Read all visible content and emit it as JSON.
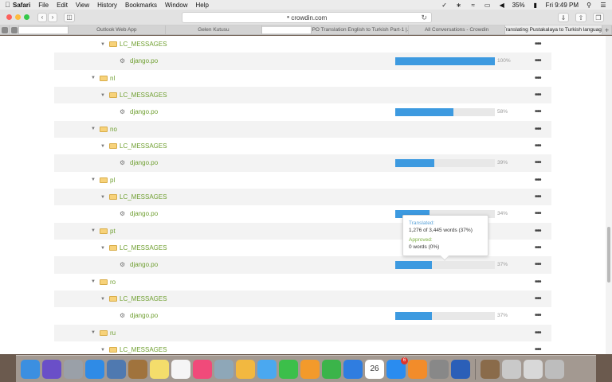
{
  "menubar": {
    "app": "Safari",
    "menus": [
      "File",
      "Edit",
      "View",
      "History",
      "Bookmarks",
      "Window",
      "Help"
    ],
    "battery": "35%",
    "clock": "Fri 9:49 PM"
  },
  "toolbar": {
    "url": "crowdin.com"
  },
  "tabs": [
    {
      "label": "Outlook Web App"
    },
    {
      "label": "Gelen Kutusu"
    },
    {
      "label": "HPO Translation English to Turkish Part-1 |..."
    },
    {
      "label": "All Conversations - Crowdin"
    },
    {
      "label": "Translating Pustakalaya to Turkish language"
    }
  ],
  "files": [
    {
      "type": "folder",
      "level": 2,
      "name": "LC_MESSAGES"
    },
    {
      "type": "file",
      "name": "django.po",
      "progress": 100,
      "pct": "100%"
    },
    {
      "type": "folder",
      "level": 1,
      "name": "nl"
    },
    {
      "type": "folder",
      "level": 2,
      "name": "LC_MESSAGES"
    },
    {
      "type": "file",
      "name": "django.po",
      "progress": 58,
      "pct": "58%"
    },
    {
      "type": "folder",
      "level": 1,
      "name": "no"
    },
    {
      "type": "folder",
      "level": 2,
      "name": "LC_MESSAGES"
    },
    {
      "type": "file",
      "name": "django.po",
      "progress": 39,
      "pct": "39%"
    },
    {
      "type": "folder",
      "level": 1,
      "name": "pl"
    },
    {
      "type": "folder",
      "level": 2,
      "name": "LC_MESSAGES"
    },
    {
      "type": "file",
      "name": "django.po",
      "progress": 34,
      "pct": "34%"
    },
    {
      "type": "folder",
      "level": 1,
      "name": "pt"
    },
    {
      "type": "folder",
      "level": 2,
      "name": "LC_MESSAGES"
    },
    {
      "type": "file",
      "name": "django.po",
      "progress": 37,
      "pct": "37%"
    },
    {
      "type": "folder",
      "level": 1,
      "name": "ro"
    },
    {
      "type": "folder",
      "level": 2,
      "name": "LC_MESSAGES"
    },
    {
      "type": "file",
      "name": "django.po",
      "progress": 37,
      "pct": "37%"
    },
    {
      "type": "folder",
      "level": 1,
      "name": "ru"
    },
    {
      "type": "folder",
      "level": 2,
      "name": "LC_MESSAGES"
    }
  ],
  "tooltip": {
    "translated_label": "Translated:",
    "translated_value": "1,276 of 3,445 words (37%)",
    "approved_label": "Approved:",
    "approved_value": "0 words (0%)"
  },
  "dock": {
    "calendar_day": "26",
    "app_store_badge": "6",
    "apps": [
      {
        "name": "finder-icon",
        "color": "#3b8fe0"
      },
      {
        "name": "siri-icon",
        "color": "#6a4fc8"
      },
      {
        "name": "launchpad-icon",
        "color": "#9aa0a8"
      },
      {
        "name": "safari-icon",
        "color": "#2f8be6"
      },
      {
        "name": "preview-icon",
        "color": "#4f79b0"
      },
      {
        "name": "notebook-icon",
        "color": "#a0733d"
      },
      {
        "name": "notes-icon",
        "color": "#f4dd6b"
      },
      {
        "name": "reminders-icon",
        "color": "#f5f5f5"
      },
      {
        "name": "itunes-icon",
        "color": "#f04a7a"
      },
      {
        "name": "image-capture-icon",
        "color": "#8ea7b8"
      },
      {
        "name": "photos-icon",
        "color": "#f2b840"
      },
      {
        "name": "messages-icon",
        "color": "#4aa8f0"
      },
      {
        "name": "facetime-icon",
        "color": "#3cbf4a"
      },
      {
        "name": "pages-icon",
        "color": "#f39a2b"
      },
      {
        "name": "numbers-icon",
        "color": "#3bb44a"
      },
      {
        "name": "keynote-icon",
        "color": "#2f7de0"
      },
      {
        "name": "calendar-icon",
        "color": "#ffffff"
      },
      {
        "name": "app-store-icon",
        "color": "#2a8cf0"
      },
      {
        "name": "ibooks-icon",
        "color": "#f28c2a"
      },
      {
        "name": "system-preferences-icon",
        "color": "#888888"
      },
      {
        "name": "word-icon",
        "color": "#2b5fb8"
      }
    ]
  }
}
